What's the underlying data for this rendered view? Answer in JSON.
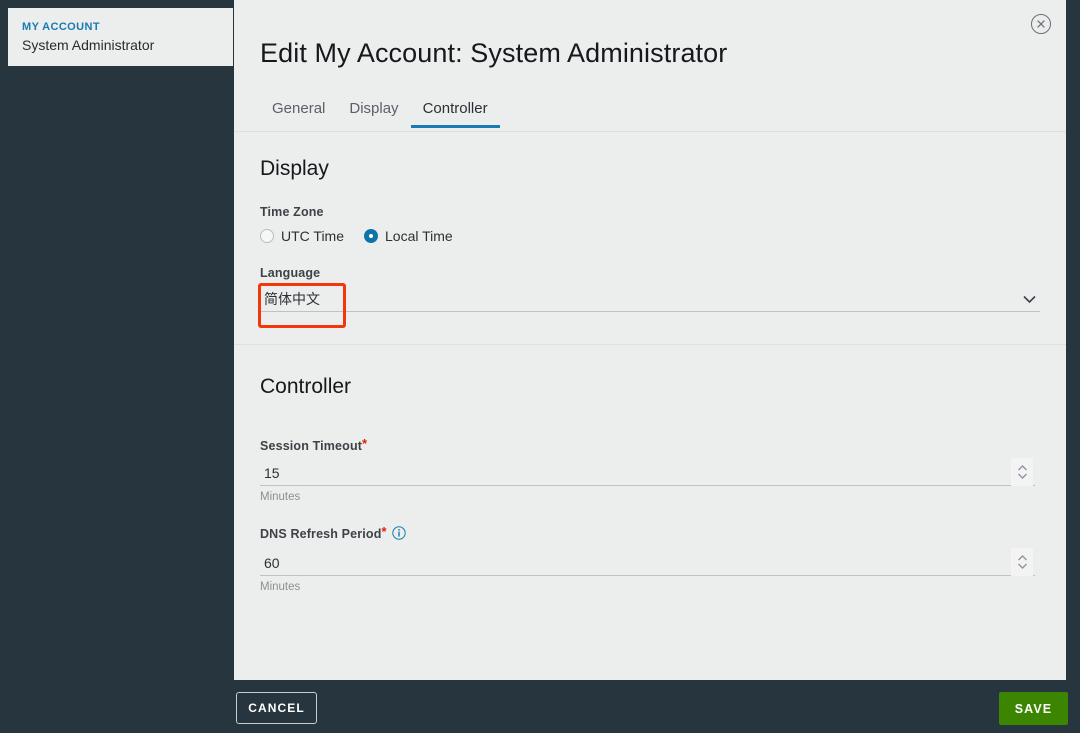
{
  "account_card": {
    "title": "MY ACCOUNT",
    "name": "System Administrator",
    "title_color": "#1a7ab4"
  },
  "modal": {
    "title": "Edit My Account: System Administrator",
    "close_icon": "close-circle-icon",
    "tabs": [
      {
        "label": "General",
        "active": false
      },
      {
        "label": "Display",
        "active": false
      },
      {
        "label": "Controller",
        "active": true
      }
    ],
    "active_tab_color": "#1a7ab4"
  },
  "display_section": {
    "heading": "Display",
    "time_zone": {
      "label": "Time Zone",
      "options": [
        {
          "label": "UTC Time",
          "selected": false
        },
        {
          "label": "Local Time",
          "selected": true
        }
      ],
      "selected_color": "#0d76a8"
    },
    "language": {
      "label": "Language",
      "value": "简体中文",
      "chevron_icon": "chevron-down-icon",
      "highlight_color": "#f4360b"
    }
  },
  "controller_section": {
    "heading": "Controller",
    "session_timeout": {
      "label": "Session Timeout",
      "required_marker": "*",
      "value": "15",
      "helper": "Minutes",
      "spinner_icon": "spinner-updown-icon"
    },
    "dns_refresh_period": {
      "label": "DNS Refresh Period",
      "required_marker": "*",
      "info_icon": "info-circle-icon",
      "value": "60",
      "helper": "Minutes",
      "spinner_icon": "spinner-updown-icon"
    }
  },
  "footer": {
    "cancel_label": "CANCEL",
    "save_label": "SAVE",
    "save_color": "#3b8500"
  }
}
